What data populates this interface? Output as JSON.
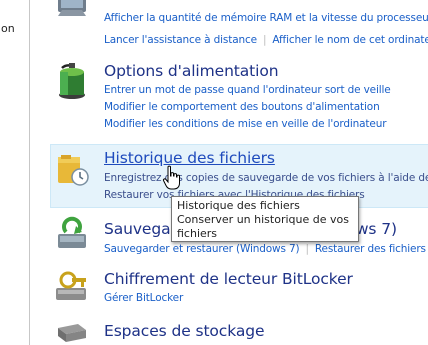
{
  "sidebar": {
    "text": "on"
  },
  "items": [
    {
      "links": [
        "Afficher la quantité de mémoire RAM et la vitesse du processeur",
        "Lancer l'assistance à distance",
        "Afficher le nom de cet ordinateur"
      ]
    },
    {
      "title": "Options d'alimentation",
      "links": [
        "Entrer un mot de passe quand l'ordinateur sort de veille",
        "Modifier le comportement des boutons d'alimentation",
        "Modifier les conditions de mise en veille de l'ordinateur"
      ]
    },
    {
      "title": "Historique des fichiers",
      "links": [
        "Enregistrez des copies de sauvegarde de vos fichiers à l'aide de l'Historique des fichiers",
        "Restaurer vos fichiers avec l'Historique des fichiers"
      ]
    },
    {
      "title": "Sauvegarder et restaurer (Windows 7)",
      "links": [
        "Sauvegarder et restaurer (Windows 7)",
        "Restaurer des fichiers à partir de la sauvegarde"
      ]
    },
    {
      "title": "Chiffrement de lecteur BitLocker",
      "links": [
        "Gérer BitLocker"
      ]
    },
    {
      "title": "Espaces de stockage",
      "links": []
    }
  ],
  "tooltip": {
    "title": "Historique des fichiers",
    "description": "Conserver un historique de vos fichiers"
  },
  "colors": {
    "link": "#1a5fc8",
    "title": "#1e3287",
    "hover_bg": "#e5f3fb"
  }
}
